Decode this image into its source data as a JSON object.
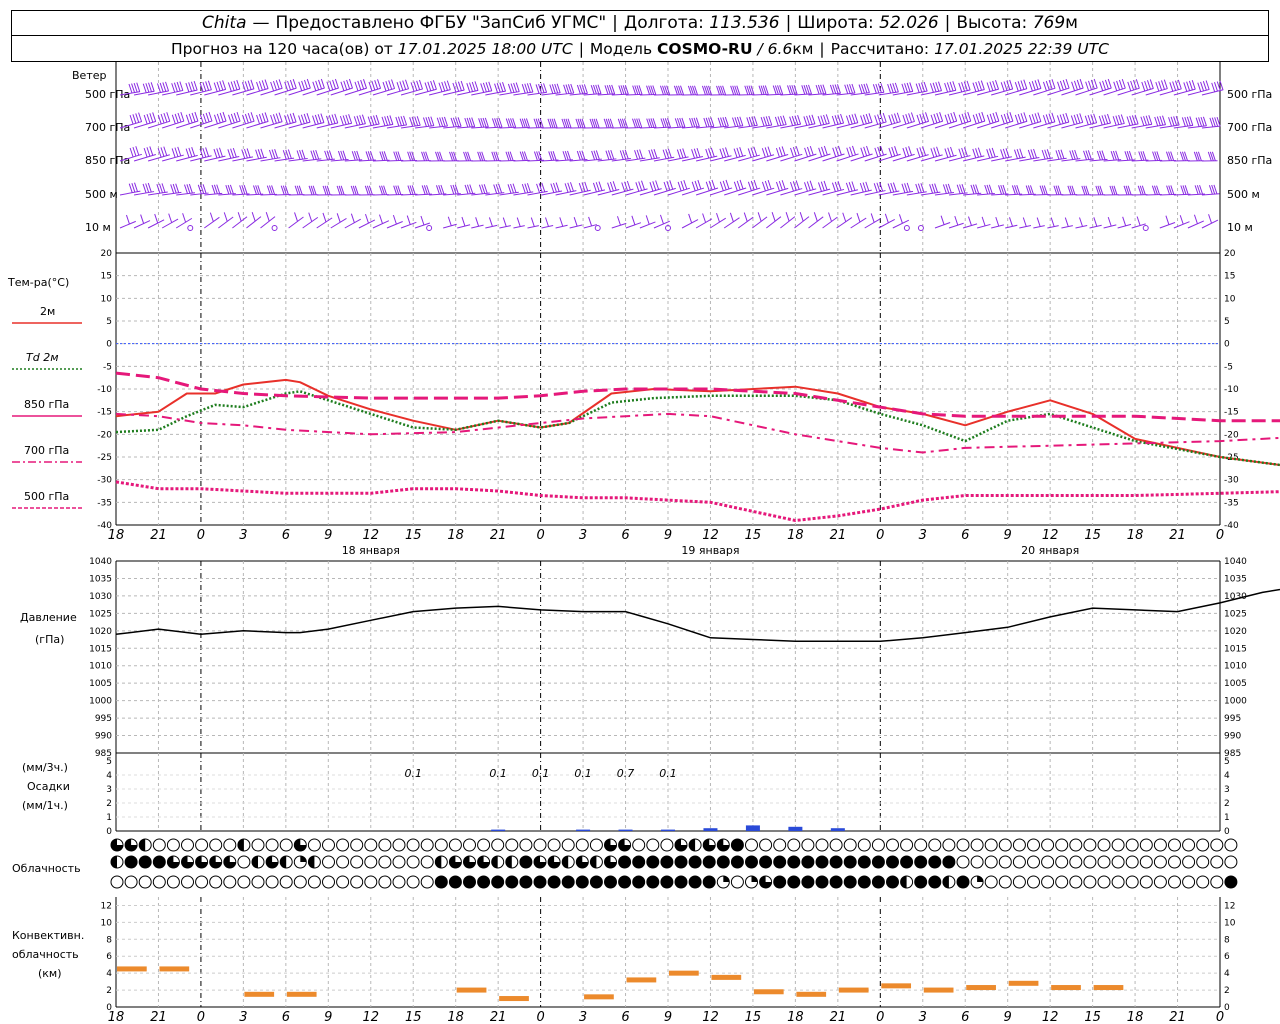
{
  "header": {
    "station": "Chita",
    "dash": "—",
    "provided_by": "Предоставлено ФГБУ \"ЗапСиб УГМС\"",
    "lon_label": "Долгота:",
    "lon_value": "113.536",
    "lat_label": "Широта:",
    "lat_value": "52.026",
    "alt_label": "Высота:",
    "alt_value": "769",
    "alt_unit": "м",
    "forecast_label": "Прогноз на 120 часа(ов) от",
    "forecast_start": "17.01.2025 18:00 UTC",
    "model_label": "Модель",
    "model_name": "COSMO-RU",
    "model_res": "/ 6.6",
    "model_res_unit": "км",
    "calc_label": "Рассчитано:",
    "calc_time": "17.01.2025 22:39 UTC"
  },
  "wind_panel": {
    "title": "Ветер",
    "levels": [
      "500 гПа",
      "700 гПа",
      "850 гПа",
      "500 м",
      "10 м"
    ],
    "barb_color": "#8a2be2"
  },
  "temp_panel": {
    "title": "Тем-ра(°C)",
    "legend": [
      {
        "label": "2м",
        "color": "#e8302a",
        "style": "solid"
      },
      {
        "label": "Td 2м",
        "color": "#1e7d1e",
        "style": "dotted"
      },
      {
        "label": "850 гПа",
        "color": "#e5187a",
        "style": "dashed"
      },
      {
        "label": "700 гПа",
        "color": "#e5187a",
        "style": "dashdot"
      },
      {
        "label": "500 гПа",
        "color": "#e5187a",
        "style": "dot"
      }
    ]
  },
  "x_axis": {
    "hour_labels": [
      "18",
      "21",
      "0",
      "3",
      "6",
      "9",
      "12",
      "15",
      "18",
      "21",
      "0",
      "3",
      "6",
      "9",
      "12",
      "15",
      "18",
      "21",
      "0",
      "3",
      "6",
      "9",
      "12",
      "15",
      "18",
      "21",
      "0"
    ],
    "day_labels": [
      {
        "index": 6,
        "text": "18 января"
      },
      {
        "index": 14,
        "text": "19 января"
      },
      {
        "index": 22,
        "text": "20 января"
      }
    ]
  },
  "pressure_panel": {
    "title": "Давление",
    "unit": "(гПа)"
  },
  "precip_panel": {
    "unit3": "(мм/3ч.)",
    "title": "Осадки",
    "unit1": "(мм/1ч.)",
    "labels": [
      {
        "x": 21,
        "text": "0.1"
      },
      {
        "x": 27,
        "text": "0.1"
      },
      {
        "x": 30,
        "text": "0.1"
      },
      {
        "x": 33,
        "text": "0.1"
      },
      {
        "x": 36,
        "text": "0.7"
      },
      {
        "x": 39,
        "text": "0.1"
      }
    ],
    "bar_color": "#2a4ad8"
  },
  "cloud_panel": {
    "title": "Облачность"
  },
  "conv_panel": {
    "title1": "Конвективн.",
    "title2": "облачность",
    "unit": "(км)",
    "color": "#ec8a2c"
  },
  "chart_data": [
    {
      "type": "line",
      "name": "temperature",
      "x_unit": "hours since 17.01.2025 18:00 UTC",
      "ylim": [
        -40,
        20
      ],
      "yticks": [
        -40,
        -35,
        -30,
        -25,
        -20,
        -15,
        -10,
        -5,
        0,
        5,
        10,
        15,
        20
      ],
      "series": [
        {
          "name": "2м",
          "points": [
            [
              0,
              -16
            ],
            [
              3,
              -15
            ],
            [
              5,
              -11
            ],
            [
              7,
              -11
            ],
            [
              9,
              -9
            ],
            [
              12,
              -8
            ],
            [
              13,
              -8.5
            ],
            [
              15,
              -11.5
            ],
            [
              18,
              -14.5
            ],
            [
              21,
              -17
            ],
            [
              24,
              -19
            ],
            [
              27,
              -17
            ],
            [
              30,
              -18.5
            ],
            [
              32,
              -17.5
            ],
            [
              35,
              -11
            ],
            [
              38,
              -10
            ],
            [
              42,
              -10.5
            ],
            [
              48,
              -9.5
            ],
            [
              51,
              -11
            ],
            [
              54,
              -14
            ],
            [
              57,
              -15.5
            ],
            [
              60,
              -18
            ],
            [
              63,
              -15
            ],
            [
              66,
              -12.5
            ],
            [
              69,
              -15.5
            ],
            [
              72,
              -21
            ],
            [
              78,
              -25
            ],
            [
              84,
              -27.5
            ],
            [
              90,
              -28
            ]
          ]
        },
        {
          "name": "Td 2м",
          "points": [
            [
              0,
              -19.5
            ],
            [
              3,
              -19
            ],
            [
              5,
              -16
            ],
            [
              7,
              -13.5
            ],
            [
              9,
              -14
            ],
            [
              12,
              -11
            ],
            [
              13,
              -10.5
            ],
            [
              15,
              -12.5
            ],
            [
              18,
              -15.5
            ],
            [
              21,
              -18.5
            ],
            [
              24,
              -19
            ],
            [
              27,
              -17
            ],
            [
              30,
              -18.5
            ],
            [
              32,
              -17.5
            ],
            [
              35,
              -13
            ],
            [
              38,
              -12
            ],
            [
              42,
              -11.5
            ],
            [
              48,
              -11.5
            ],
            [
              51,
              -12.5
            ],
            [
              54,
              -15.5
            ],
            [
              57,
              -18
            ],
            [
              60,
              -21.5
            ],
            [
              63,
              -17
            ],
            [
              66,
              -15.5
            ],
            [
              69,
              -18.5
            ],
            [
              72,
              -21.5
            ],
            [
              78,
              -25
            ],
            [
              84,
              -27.5
            ],
            [
              90,
              -28
            ]
          ]
        },
        {
          "name": "850 гПа",
          "points": [
            [
              0,
              -6.5
            ],
            [
              3,
              -7.5
            ],
            [
              6,
              -10
            ],
            [
              9,
              -11
            ],
            [
              12,
              -11.5
            ],
            [
              18,
              -12
            ],
            [
              24,
              -12
            ],
            [
              27,
              -12
            ],
            [
              30,
              -11.5
            ],
            [
              33,
              -10.5
            ],
            [
              36,
              -10
            ],
            [
              42,
              -10
            ],
            [
              48,
              -11
            ],
            [
              54,
              -14
            ],
            [
              57,
              -15.5
            ],
            [
              60,
              -16
            ],
            [
              66,
              -16
            ],
            [
              72,
              -16
            ],
            [
              78,
              -17
            ],
            [
              90,
              -17
            ]
          ]
        },
        {
          "name": "700 гПа",
          "points": [
            [
              0,
              -15.5
            ],
            [
              3,
              -16
            ],
            [
              6,
              -17.5
            ],
            [
              9,
              -18
            ],
            [
              12,
              -19
            ],
            [
              18,
              -20
            ],
            [
              24,
              -19.5
            ],
            [
              30,
              -17.5
            ],
            [
              33,
              -16.5
            ],
            [
              36,
              -16
            ],
            [
              39,
              -15.5
            ],
            [
              42,
              -16
            ],
            [
              48,
              -20
            ],
            [
              54,
              -23
            ],
            [
              57,
              -24
            ],
            [
              60,
              -23
            ],
            [
              66,
              -22.5
            ],
            [
              72,
              -22
            ],
            [
              78,
              -21.5
            ],
            [
              84,
              -20.5
            ],
            [
              90,
              -20.5
            ]
          ]
        },
        {
          "name": "500 гПа",
          "points": [
            [
              0,
              -30.5
            ],
            [
              3,
              -32
            ],
            [
              6,
              -32
            ],
            [
              9,
              -32.5
            ],
            [
              12,
              -33
            ],
            [
              18,
              -33
            ],
            [
              21,
              -32
            ],
            [
              24,
              -32
            ],
            [
              27,
              -32.5
            ],
            [
              30,
              -33.5
            ],
            [
              33,
              -34
            ],
            [
              36,
              -34
            ],
            [
              39,
              -34.5
            ],
            [
              42,
              -35
            ],
            [
              45,
              -37
            ],
            [
              48,
              -39
            ],
            [
              51,
              -38
            ],
            [
              54,
              -36.5
            ],
            [
              57,
              -34.5
            ],
            [
              60,
              -33.5
            ],
            [
              66,
              -33.5
            ],
            [
              72,
              -33.5
            ],
            [
              78,
              -33
            ],
            [
              84,
              -32.5
            ],
            [
              90,
              -32.5
            ]
          ]
        }
      ]
    },
    {
      "type": "line",
      "name": "pressure",
      "ylim": [
        985,
        1040
      ],
      "yticks": [
        985,
        990,
        995,
        1000,
        1005,
        1010,
        1015,
        1020,
        1025,
        1030,
        1035,
        1040
      ],
      "series": [
        {
          "name": "pressure",
          "points": [
            [
              0,
              1019
            ],
            [
              3,
              1020.5
            ],
            [
              6,
              1019
            ],
            [
              9,
              1020
            ],
            [
              12,
              1019.5
            ],
            [
              13,
              1019.5
            ],
            [
              15,
              1020.5
            ],
            [
              18,
              1023
            ],
            [
              21,
              1025.5
            ],
            [
              24,
              1026.5
            ],
            [
              27,
              1027
            ],
            [
              30,
              1026
            ],
            [
              33,
              1025.5
            ],
            [
              36,
              1025.5
            ],
            [
              39,
              1022
            ],
            [
              42,
              1018
            ],
            [
              45,
              1017.5
            ],
            [
              48,
              1017
            ],
            [
              54,
              1017
            ],
            [
              57,
              1018
            ],
            [
              60,
              1019.5
            ],
            [
              63,
              1021
            ],
            [
              66,
              1024
            ],
            [
              69,
              1026.5
            ],
            [
              72,
              1026
            ],
            [
              75,
              1025.5
            ],
            [
              78,
              1028
            ],
            [
              81,
              1031
            ],
            [
              84,
              1033
            ],
            [
              87,
              1035
            ],
            [
              90,
              1036.5
            ],
            [
              96,
              1037.5
            ],
            [
              99,
              1038.5
            ]
          ]
        }
      ]
    },
    {
      "type": "bar",
      "name": "precipitation",
      "ylim": [
        0,
        5
      ],
      "yticks": [
        0,
        1,
        2,
        3,
        4,
        5
      ],
      "bars": [
        [
          27,
          0.1
        ],
        [
          33,
          0.1
        ],
        [
          36,
          0.1
        ],
        [
          39,
          0.1
        ],
        [
          42,
          0.2
        ],
        [
          45,
          0.4
        ],
        [
          48,
          0.3
        ],
        [
          51,
          0.2
        ]
      ]
    },
    {
      "type": "bar",
      "name": "convective_cloud",
      "ylim": [
        0,
        13
      ],
      "yticks": [
        0,
        2,
        4,
        6,
        8,
        10,
        12
      ],
      "segments": [
        [
          0,
          4.5
        ],
        [
          3,
          4.5
        ],
        [
          9,
          1.5
        ],
        [
          12,
          1.5
        ],
        [
          24,
          2
        ],
        [
          27,
          1
        ],
        [
          33,
          1.2
        ],
        [
          36,
          3.2
        ],
        [
          39,
          4
        ],
        [
          42,
          3.5
        ],
        [
          45,
          1.8
        ],
        [
          48,
          1.5
        ],
        [
          51,
          2
        ],
        [
          54,
          2.5
        ],
        [
          57,
          2
        ],
        [
          60,
          2.3
        ],
        [
          63,
          2.8
        ],
        [
          66,
          2.3
        ],
        [
          69,
          2.3
        ]
      ]
    },
    {
      "type": "heatmap",
      "name": "cloud_cover",
      "rows": [
        "rrhcccccchcccrcccccccccccccccccccccrrcccrhrrfcccccccccccccccccccccccccccccccccccccc",
        "hfffrrrrrchrhqhcccccccchrrrhhfrrhrhrffffffffffffffffffffffffcccccccccccccccccccccccccc",
        "cccccccccccccccccccccccffffffffffffffffffffqcqrfffffffffhffhfqcccccccccccccccccfffff"
      ]
    }
  ]
}
